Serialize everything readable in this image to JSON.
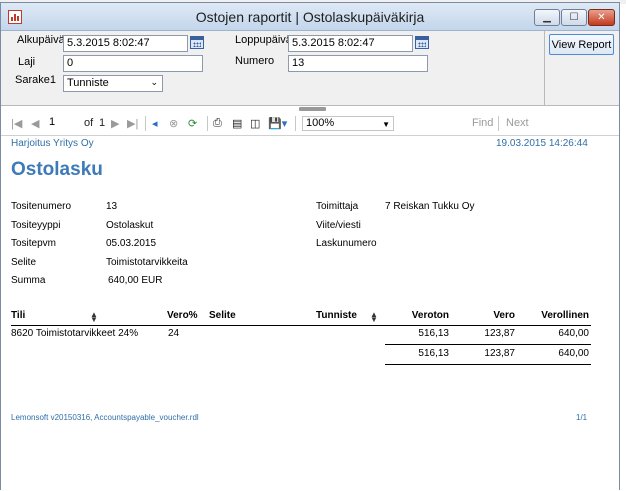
{
  "window": {
    "title": "Ostojen raportit | Ostolaskupäiväkirja"
  },
  "params": {
    "alkupaiva_label": "Alkupäivä",
    "alkupaiva_value": "5.3.2015 8:02:47",
    "loppupaiva_label": "Loppupäivä",
    "loppupaiva_value": "5.3.2015 8:02:47",
    "laji_label": "Laji",
    "laji_value": "0",
    "numero_label": "Numero",
    "numero_value": "13",
    "sarake1_label": "Sarake1",
    "sarake1_value": "Tunniste",
    "view_report_label": "View Report"
  },
  "toolbar": {
    "page_current": "1",
    "of_label": "of",
    "page_total": "1",
    "zoom": "100%",
    "find_label": "Find",
    "next_label": "Next"
  },
  "report": {
    "company": "Harjoitus Yritys Oy",
    "printed_at": "19.03.2015 14:26:44",
    "title": "Ostolasku",
    "left_fields": [
      {
        "label": "Tositenumero",
        "value": "13"
      },
      {
        "label": "Tositeyyppi",
        "value": "Ostolaskut"
      },
      {
        "label": "Tositepvm",
        "value": "05.03.2015"
      },
      {
        "label": "Selite",
        "value": "Toimistotarvikkeita"
      },
      {
        "label": "Summa",
        "value": "640,00 EUR"
      }
    ],
    "right_fields": [
      {
        "label": "Toimittaja",
        "value": "7 Reiskan Tukku Oy"
      },
      {
        "label": "Viite/viesti",
        "value": ""
      },
      {
        "label": "Laskunumero",
        "value": ""
      }
    ],
    "table": {
      "headers": {
        "tili": "Tili",
        "vero_pct": "Vero%",
        "selite": "Selite",
        "tunniste": "Tunniste",
        "veroton": "Veroton",
        "vero": "Vero",
        "verollinen": "Verollinen"
      },
      "rows": [
        {
          "tili": "8620 Toimistotarvikkeet 24%",
          "vero_pct": "24",
          "selite": "",
          "tunniste": "",
          "veroton": "516,13",
          "vero": "123,87",
          "verollinen": "640,00"
        }
      ],
      "totals": {
        "veroton": "516,13",
        "vero": "123,87",
        "verollinen": "640,00"
      }
    },
    "footer_left": "Lemonsoft v20150316, Accountspayable_voucher.rdl",
    "footer_right": "1/1"
  }
}
